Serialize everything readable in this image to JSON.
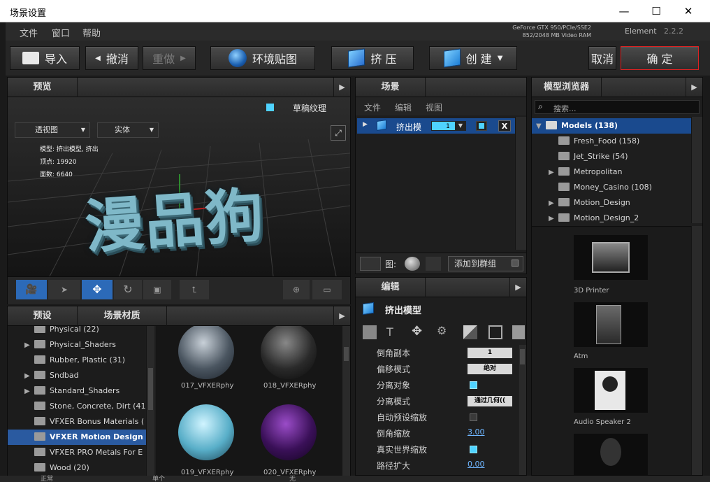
{
  "window": {
    "title": "场景设置"
  },
  "menu": [
    "文件",
    "窗口",
    "帮助"
  ],
  "gpu": {
    "line1": "GeForce GTX 950/PCIe/SSE2",
    "line2": "852/2048 MB Video RAM"
  },
  "app": {
    "name": "Element",
    "version": "2.2.2"
  },
  "toolbar": {
    "import": "导入",
    "undo": "撤消",
    "redo": "重做",
    "env": "环境贴图",
    "extrude": "挤 压",
    "create": "创 建",
    "cancel": "取消",
    "ok": "确 定"
  },
  "preview": {
    "tab": "预览",
    "draft_label": "草稿纹理",
    "view_select": "透视图",
    "mode_select": "实体",
    "info": {
      "model_k": "模型:",
      "model_v": "挤出模型, 挤出",
      "verts_k": "顶点:",
      "verts_v": "19920",
      "faces_k": "面数:",
      "faces_v": "6640"
    },
    "text3d": "漫品狗"
  },
  "scene": {
    "tab": "场景",
    "menu": [
      "文件",
      "编辑",
      "视图"
    ],
    "item_label": "挤出模",
    "item_num": "1",
    "x": "X",
    "bottom_label": "图:",
    "group_btn": "添加到群组"
  },
  "browser": {
    "tab": "模型浏览器",
    "search_placeholder": "搜索...",
    "tree": [
      {
        "label": "Models (138)",
        "root": true
      },
      {
        "label": "Fresh_Food (158)",
        "arrow": false
      },
      {
        "label": "Jet_Strike (54)",
        "arrow": false
      },
      {
        "label": "Metropolitan",
        "arrow": true
      },
      {
        "label": "Money_Casino (108)",
        "arrow": false
      },
      {
        "label": "Motion_Design",
        "arrow": true
      },
      {
        "label": "Motion_Design_2",
        "arrow": true
      }
    ],
    "models": [
      "3D Printer",
      "Atm",
      "Audio Speaker 2"
    ]
  },
  "presets": {
    "tab1": "预设",
    "tab2": "场景材质",
    "folders": [
      {
        "label": "Physical (22)",
        "arrow": false
      },
      {
        "label": "Physical_Shaders",
        "arrow": true
      },
      {
        "label": "Rubber, Plastic (31)",
        "arrow": false
      },
      {
        "label": "Sndbad",
        "arrow": true
      },
      {
        "label": "Standard_Shaders",
        "arrow": true
      },
      {
        "label": "Stone, Concrete, Dirt (41",
        "arrow": false
      },
      {
        "label": "VFXER Bonus Materials (",
        "arrow": false
      },
      {
        "label": "VFXER Motion Design",
        "arrow": false,
        "selected": true
      },
      {
        "label": "VFXER PRO Metals For E",
        "arrow": false
      },
      {
        "label": "Wood (20)",
        "arrow": false
      }
    ],
    "materials": [
      "017_VFXERphy",
      "018_VFXERphy",
      "019_VFXERphy",
      "020_VFXERphy"
    ]
  },
  "edit": {
    "tab": "编辑",
    "title": "挤出模型",
    "rows": [
      {
        "label": "倒角副本",
        "type": "box",
        "value": "1"
      },
      {
        "label": "偏移模式",
        "type": "box",
        "value": "绝对"
      },
      {
        "label": "分离对象",
        "type": "check",
        "value": "on"
      },
      {
        "label": "分离模式",
        "type": "box",
        "value": "通过几何(("
      },
      {
        "label": "自动预设缩放",
        "type": "check",
        "value": "off"
      },
      {
        "label": "倒角缩放",
        "type": "link",
        "value": "3.00"
      },
      {
        "label": "真实世界缩放",
        "type": "check",
        "value": "on"
      },
      {
        "label": "路径扩大",
        "type": "link",
        "value": "0.00"
      }
    ]
  },
  "statusbar": {
    "left": "正常",
    "mid": "单个",
    "right": "无"
  }
}
